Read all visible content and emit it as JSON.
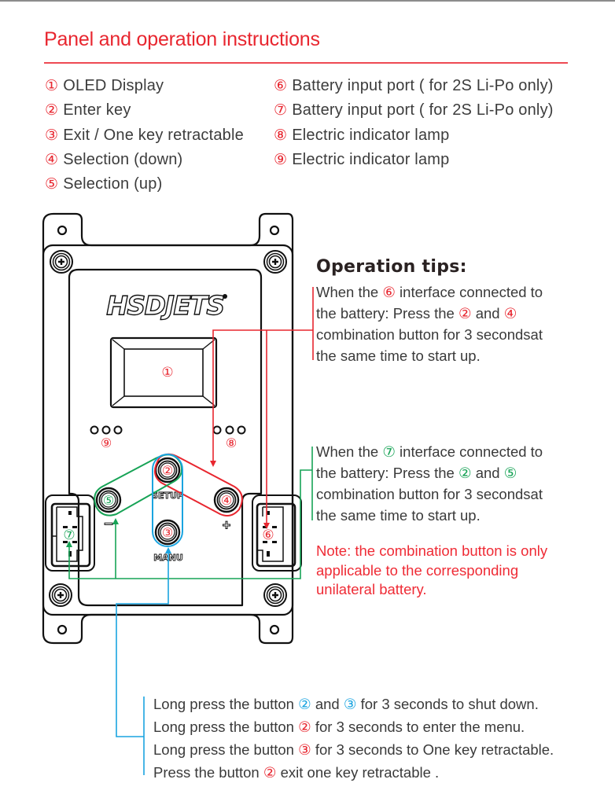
{
  "header": {
    "title": "Panel and operation instructions"
  },
  "legend": {
    "left": [
      {
        "num": "①",
        "label": "OLED Display"
      },
      {
        "num": "②",
        "label": "Enter key"
      },
      {
        "num": "③",
        "label": "Exit / One key retractable"
      },
      {
        "num": "④",
        "label": "Selection (down)"
      },
      {
        "num": "⑤",
        "label": "Selection (up)"
      }
    ],
    "right": [
      {
        "num": "⑥",
        "label": "Battery input port ( for 2S Li-Po only)"
      },
      {
        "num": "⑦",
        "label": "Battery input port ( for 2S Li-Po only)"
      },
      {
        "num": "⑧",
        "label": "Electric indicator lamp"
      },
      {
        "num": "⑨",
        "label": "Electric indicator lamp"
      }
    ]
  },
  "device": {
    "brand": "HSDJETS",
    "display_marker": "①",
    "button_labels": {
      "setup": "SETUP",
      "menu": "MANU",
      "minus": "−",
      "plus": "+"
    },
    "markers": {
      "lamps_left": "⑨",
      "lamps_right": "⑧",
      "btn_enter": "②",
      "btn_exit": "③",
      "btn_down": "④",
      "btn_up": "⑤",
      "port_right": "⑥",
      "port_left": "⑦"
    }
  },
  "colors": {
    "accent_red": "#e8262f",
    "green": "#17a356",
    "blue": "#1aa4e0",
    "text": "#3a3a3a"
  },
  "tips": {
    "title": "Operation tips:",
    "tip1": {
      "lines": [
        {
          "pre": "When the ",
          "num": "⑥",
          "post": " interface connected to"
        },
        {
          "pre": "the battery: Press the ",
          "num": "②",
          "mid": " and ",
          "num2": "④",
          "post": ""
        },
        {
          "pre": "combination button for 3 secondsat",
          "num": "",
          "post": ""
        },
        {
          "pre": "the same time to start up.",
          "num": "",
          "post": ""
        }
      ]
    },
    "tip2": {
      "lines": [
        {
          "pre": "When the ",
          "num": "⑦",
          "post": " interface connected to"
        },
        {
          "pre": "the battery: Press the ",
          "num": "②",
          "mid": " and ",
          "num2": "⑤",
          "post": ""
        },
        {
          "pre": "combination button for 3 secondsat",
          "num": "",
          "post": ""
        },
        {
          "pre": "the same time to start up.",
          "num": "",
          "post": ""
        }
      ]
    },
    "note": [
      "Note: the combination button is only",
      "applicable to the corresponding",
      "unilateral battery."
    ]
  },
  "bottom_instructions": [
    {
      "pre": "Long press the button ",
      "num": "②",
      "mid": " and ",
      "num2": "③",
      "post": " for 3 seconds to shut down."
    },
    {
      "pre": "Long press the button ",
      "num": "②",
      "post": " for 3 seconds to enter the menu."
    },
    {
      "pre": "Long press the button ",
      "num": "③",
      "post": " for 3 seconds to One key retractable."
    },
    {
      "pre": "Press the button ",
      "num": "②",
      "post": "  exit one key retractable ."
    }
  ]
}
